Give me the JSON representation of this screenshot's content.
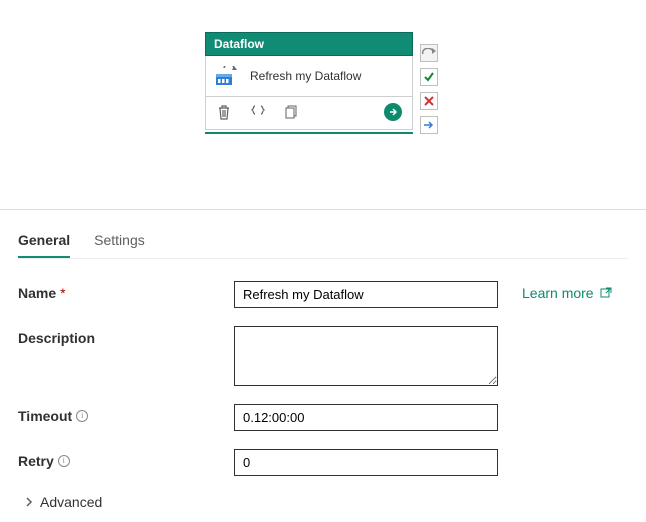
{
  "activity": {
    "header_label": "Dataflow",
    "title": "Refresh my Dataflow",
    "footer_icons": {
      "delete": "delete-icon",
      "braces": "code-braces-icon",
      "copy": "copy-icon",
      "run": "run-arrow-icon"
    },
    "side_icons": {
      "deactivate": "deactivate-icon",
      "success": "checkmark-icon",
      "fail": "cross-icon",
      "skip": "skip-arrow-icon"
    }
  },
  "panel": {
    "tabs": [
      {
        "id": "general",
        "label": "General",
        "active": true
      },
      {
        "id": "settings",
        "label": "Settings",
        "active": false
      }
    ],
    "learn_more": "Learn more",
    "fields": {
      "name_label": "Name",
      "name_value": "Refresh my Dataflow",
      "description_label": "Description",
      "description_value": "",
      "timeout_label": "Timeout",
      "timeout_value": "0.12:00:00",
      "retry_label": "Retry",
      "retry_value": "0",
      "advanced_label": "Advanced"
    }
  },
  "colors": {
    "accent": "#128c74",
    "error": "#a80000"
  }
}
